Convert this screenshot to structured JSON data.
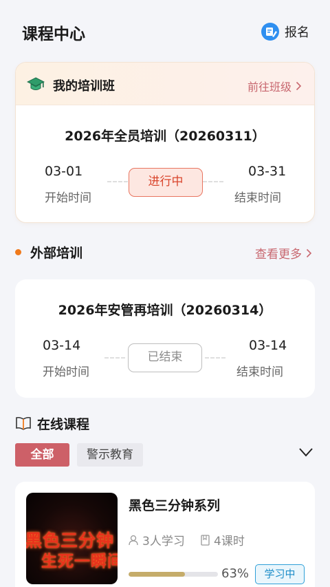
{
  "header": {
    "title": "课程中心",
    "signup_label": "报名",
    "signup_icon": "edit-badge-icon"
  },
  "my_training": {
    "title": "我的培训班",
    "link_label": "前往班级",
    "course": {
      "name": "2026年全员培训（20260311）",
      "start_date": "03-01",
      "start_label": "开始时间",
      "status": "进行中",
      "end_date": "03-31",
      "end_label": "结束时间"
    }
  },
  "external_training": {
    "title": "外部培训",
    "more_label": "查看更多",
    "course": {
      "name": "2026年安管再培训（20260314）",
      "start_date": "03-14",
      "start_label": "开始时间",
      "status": "已结束",
      "end_date": "03-14",
      "end_label": "结束时间"
    }
  },
  "online_courses": {
    "title": "在线课程",
    "tabs": [
      {
        "label": "全部",
        "active": true
      },
      {
        "label": "警示教育",
        "active": false
      }
    ],
    "items": [
      {
        "title": "黑色三分钟系列",
        "thumbnail_text": [
          "黑色三分钟",
          "生死一瞬间"
        ],
        "learners": "3人学习",
        "lessons": "4课时",
        "progress": 0.63,
        "progress_label": "63%",
        "status": "学习中"
      }
    ]
  },
  "colors": {
    "accent": "#cd6068",
    "link": "#c8676f",
    "active_status": "#d9452c",
    "dot": "#f07a1c",
    "badge": "#1b8cc8",
    "progress": "#c5ac6a"
  }
}
